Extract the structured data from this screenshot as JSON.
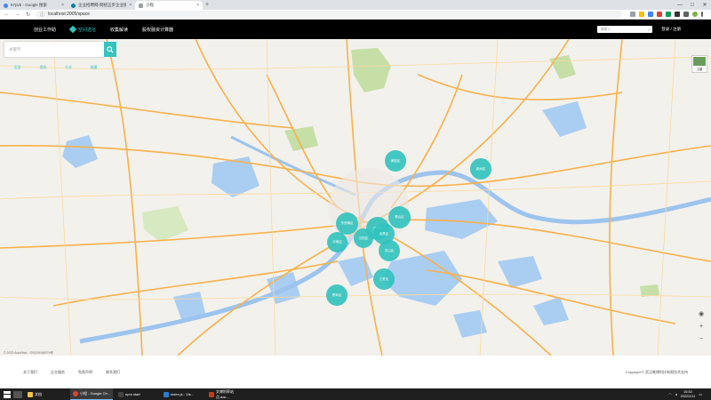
{
  "browser": {
    "tabs": [
      {
        "title": "57pvb - Google 搜索",
        "favicon": "google-icon"
      },
      {
        "title": "企业招聘网-网招五步企业版-57...",
        "favicon": "bing-icon"
      },
      {
        "title": "小程",
        "favicon": "page-icon"
      }
    ],
    "url": "localhost:2005/space"
  },
  "app": {
    "nav": [
      "创业工作助",
      "空间选址",
      "收集解读",
      "股权融资计算器"
    ],
    "search_placeholder": "请输入",
    "login": "登录 / 注册"
  },
  "map": {
    "search_placeholder": "关键字",
    "filters": [
      "区县",
      "类别",
      "行业",
      "规模"
    ],
    "layer_label": "卫星",
    "attribution": "© 2022 AutoNavi - GS(2019)6379号",
    "clusters": [
      "黄陂区",
      "新洲区",
      "东西湖区",
      "汉阳区",
      "江岸区",
      "青山区",
      "汉南区",
      "武昌区",
      "洪山区",
      "蔡甸区",
      "江夏区",
      "江夏区"
    ],
    "colors": {
      "cluster": "#30c2be",
      "land": "#f3f1ec",
      "water": "#aacdf2",
      "park": "#c5dfa7",
      "road": "#f9b049"
    }
  },
  "footer": {
    "links": [
      "关于我们",
      "企业服务",
      "免责声明",
      "联系我们"
    ],
    "copyright": "Copyright © 武汉唯博科技有限技术支持"
  },
  "taskbar": {
    "apps": [
      "文档",
      "小程 - Google Ch...",
      "npm start",
      "index.js - Vis...",
      "文博利率站点.doc..."
    ],
    "time": "15:33",
    "date": "2022/2/11"
  }
}
